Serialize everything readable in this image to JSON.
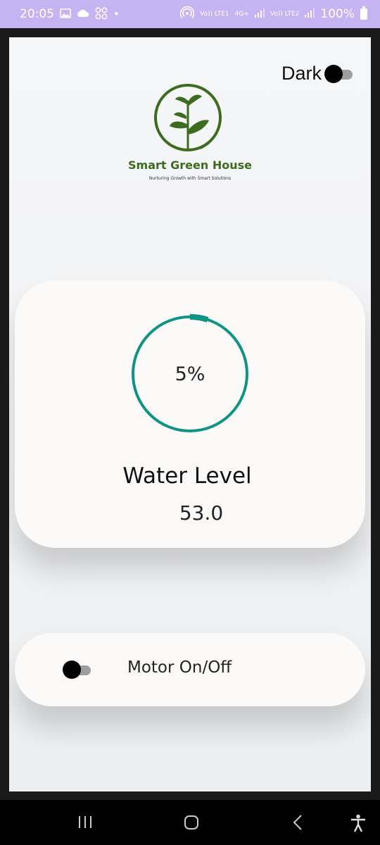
{
  "status_bar": {
    "time": "20:05",
    "left_icons": [
      "gallery-icon",
      "cloud-icon",
      "app-grid-icon",
      "dot-icon"
    ],
    "signal_labels": [
      "Vo)) LTE1",
      "4G+",
      "Vo)) LTE2"
    ],
    "battery": "100%"
  },
  "header": {
    "dark_label": "Dark",
    "dark_enabled": false
  },
  "logo": {
    "brand": "Smart Green House",
    "tagline": "Nurturing Growth with Smart Solutions",
    "color": "#3d6b1f"
  },
  "water": {
    "percent_label": "5%",
    "percent_value": 5,
    "title": "Water Level",
    "reading": "53.0",
    "ring_color": "#0e9385"
  },
  "motor": {
    "label": "Motor On/Off",
    "enabled": false
  },
  "nav_bar": {
    "buttons": [
      "recents-icon",
      "home-icon",
      "back-icon",
      "accessibility-icon"
    ]
  }
}
